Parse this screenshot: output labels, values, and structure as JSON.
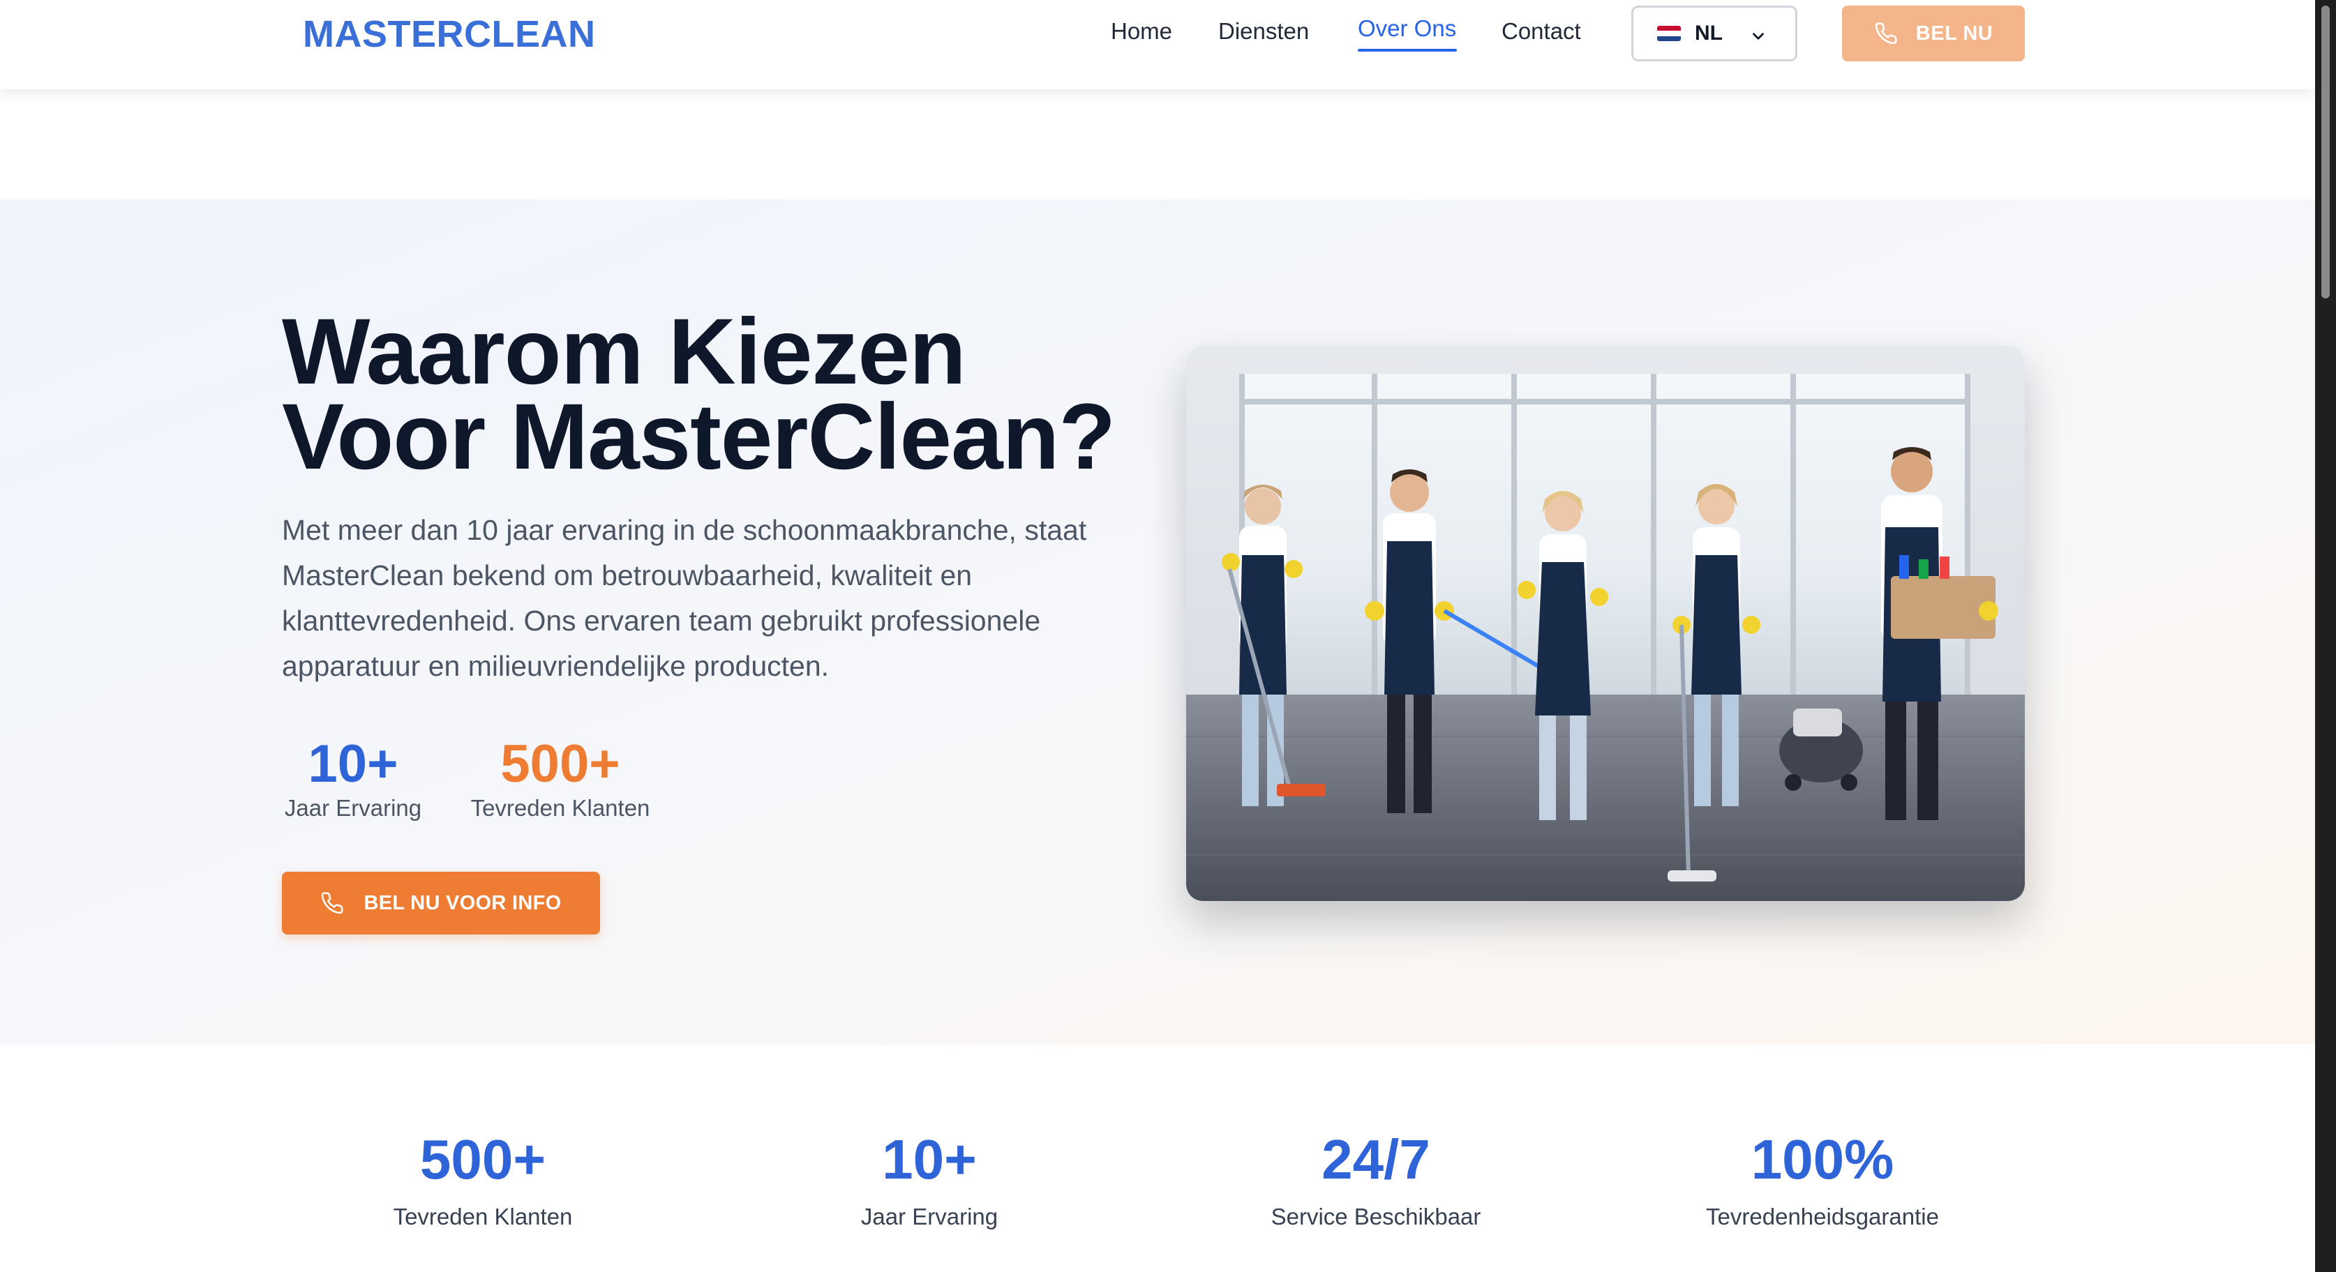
{
  "header": {
    "logo": "MASTERCLEAN",
    "nav": [
      "Home",
      "Diensten",
      "Over Ons",
      "Contact"
    ],
    "active_nav": "Over Ons",
    "language": "NL",
    "call_button": "BEL NU"
  },
  "hero": {
    "title_line1": "Waarom Kiezen",
    "title_line2": "Voor MasterClean?",
    "text": "Met meer dan 10 jaar ervaring in de schoonmaakbranche, staat MasterClean bekend om betrouwbaarheid, kwaliteit en klanttevredenheid. Ons ervaren team gebruikt professionele apparatuur en milieuvriendelijke producten.",
    "stats": [
      {
        "value": "10+",
        "label": "Jaar Ervaring"
      },
      {
        "value": "500+",
        "label": "Tevreden Klanten"
      }
    ],
    "button": "BEL NU VOOR INFO"
  },
  "stats": [
    {
      "value": "500+",
      "label": "Tevreden Klanten"
    },
    {
      "value": "10+",
      "label": "Jaar Ervaring"
    },
    {
      "value": "24/7",
      "label": "Service Beschikbaar"
    },
    {
      "value": "100%",
      "label": "Tevredenheidsgarantie"
    }
  ],
  "colors": {
    "primary_blue": "#2f63d8",
    "accent_orange": "#ee7c33",
    "call_button_bg": "#f5b58a"
  },
  "icons": {
    "phone": "phone-icon",
    "chevron": "chevron-down-icon",
    "flag": "flag-nl-icon"
  }
}
